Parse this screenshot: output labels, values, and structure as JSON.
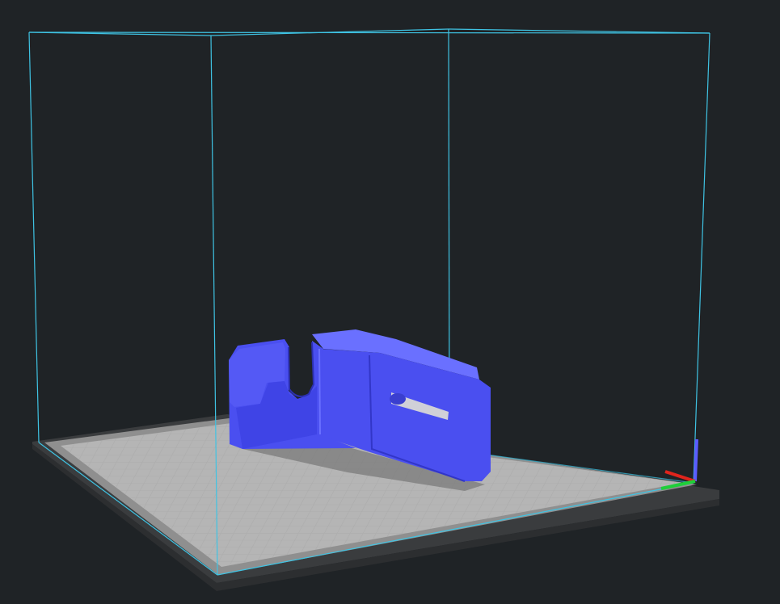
{
  "viewport": {
    "name": "3d-print-preview",
    "background": "#1f2326"
  },
  "colors": {
    "build_volume_edge": "#3fc3e3",
    "bed_frame": "#3a3c3e",
    "bed_surface": "#b6b6b6",
    "bed_grid": "#a2a2a2",
    "bed_border": "#8e8e8e",
    "model_fill": "#4a4ff0",
    "model_highlight": "#6a70ff",
    "model_shadow": "#2f33b8",
    "axis_x": "#e0241c",
    "axis_y": "#1fcf3a",
    "axis_z": "#5a5cff"
  },
  "icons": {
    "axis_gizmo": "xyz-axis-icon"
  }
}
